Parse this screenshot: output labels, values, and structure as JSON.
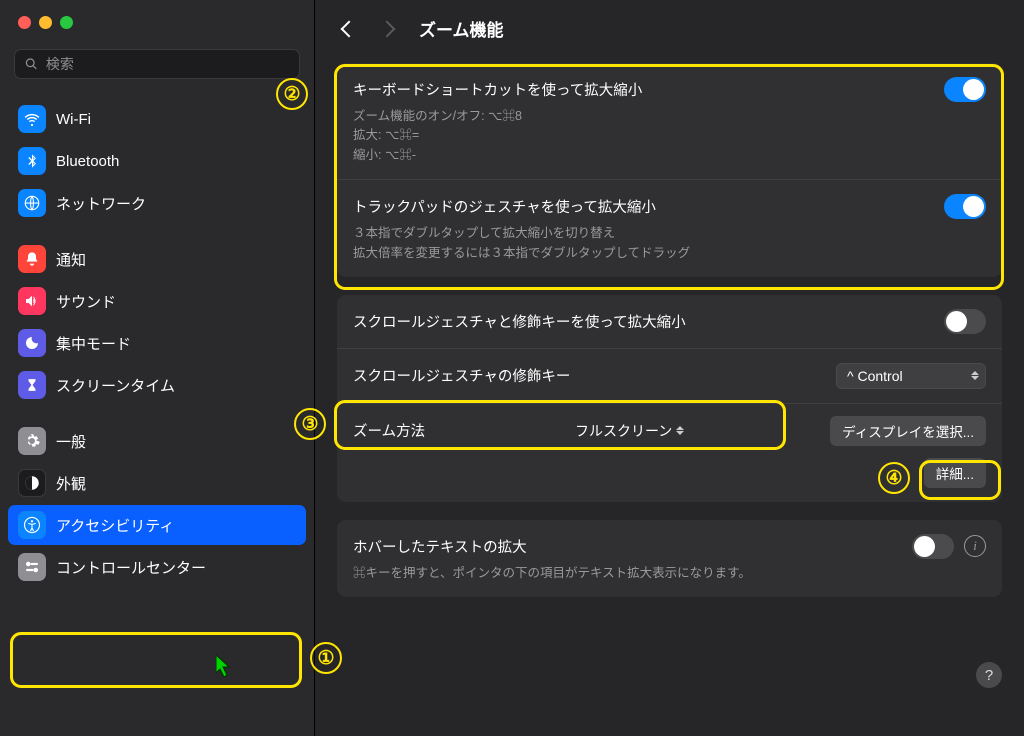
{
  "search": {
    "placeholder": "検索"
  },
  "sidebar": {
    "groups": [
      {
        "items": [
          {
            "label": "Wi-Fi",
            "icon": "wifi"
          },
          {
            "label": "Bluetooth",
            "icon": "bluetooth"
          },
          {
            "label": "ネットワーク",
            "icon": "network"
          }
        ]
      },
      {
        "items": [
          {
            "label": "通知",
            "icon": "notif"
          },
          {
            "label": "サウンド",
            "icon": "sound"
          },
          {
            "label": "集中モード",
            "icon": "focus"
          },
          {
            "label": "スクリーンタイム",
            "icon": "screentime"
          }
        ]
      },
      {
        "items": [
          {
            "label": "一般",
            "icon": "general"
          },
          {
            "label": "外観",
            "icon": "appearance"
          },
          {
            "label": "アクセシビリティ",
            "icon": "accessibility",
            "selected": true
          },
          {
            "label": "コントロールセンター",
            "icon": "controlcenter"
          }
        ]
      }
    ]
  },
  "page": {
    "title": "ズーム機能",
    "sections": {
      "keyboard": {
        "title": "キーボードショートカットを使って拡大縮小",
        "desc": "ズーム機能のオン/オフ: ⌥⌘8\n拡大: ⌥⌘=\n縮小: ⌥⌘-",
        "on": true
      },
      "trackpad": {
        "title": "トラックパッドのジェスチャを使って拡大縮小",
        "desc": "３本指でダブルタップして拡大縮小を切り替え\n拡大倍率を変更するには３本指でダブルタップしてドラッグ",
        "on": true
      },
      "scroll": {
        "title": "スクロールジェスチャと修飾キーを使って拡大縮小",
        "on": false
      },
      "modifier": {
        "label": "スクロールジェスチャの修飾キー",
        "value": "^ Control"
      },
      "zoomMethod": {
        "label": "ズーム方法",
        "value": "フルスクリーン",
        "chooseDisplay": "ディスプレイを選択...",
        "advanced": "詳細..."
      },
      "hoverText": {
        "title": "ホバーしたテキストの拡大",
        "desc": "⌘キーを押すと、ポインタの下の項目がテキスト拡大表示になります。",
        "on": false
      }
    }
  },
  "annotations": {
    "n1": "①",
    "n2": "②",
    "n3": "③",
    "n4": "④"
  }
}
